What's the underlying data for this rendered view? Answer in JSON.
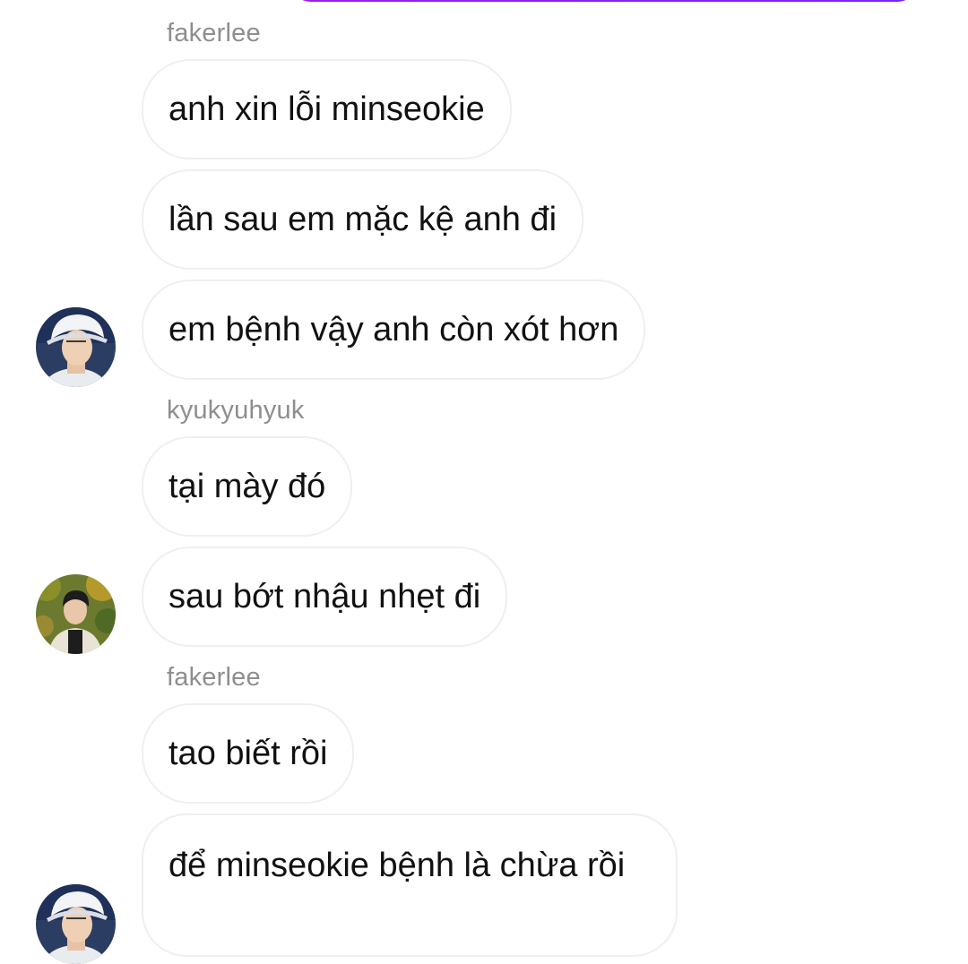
{
  "colors": {
    "outgoing_bubble": "#8a1ff3",
    "bubble_border": "#efefef",
    "sender_text": "#8e8e8e",
    "message_text": "#111111"
  },
  "thread": [
    {
      "sender": "fakerlee",
      "avatar": "avatar-fakerlee",
      "messages": [
        "anh xin lỗi minseokie",
        "lần sau em mặc kệ anh đi",
        "em bệnh vậy anh còn xót hơn"
      ]
    },
    {
      "sender": "kyukyuhyuk",
      "avatar": "avatar-kyukyuhyuk",
      "messages": [
        "tại mày đó",
        "sau bớt nhậu nhẹt đi"
      ]
    },
    {
      "sender": "fakerlee",
      "avatar": "avatar-fakerlee",
      "messages": [
        "tao biết rồi",
        "để minseokie bệnh là chừa rồi"
      ]
    }
  ]
}
